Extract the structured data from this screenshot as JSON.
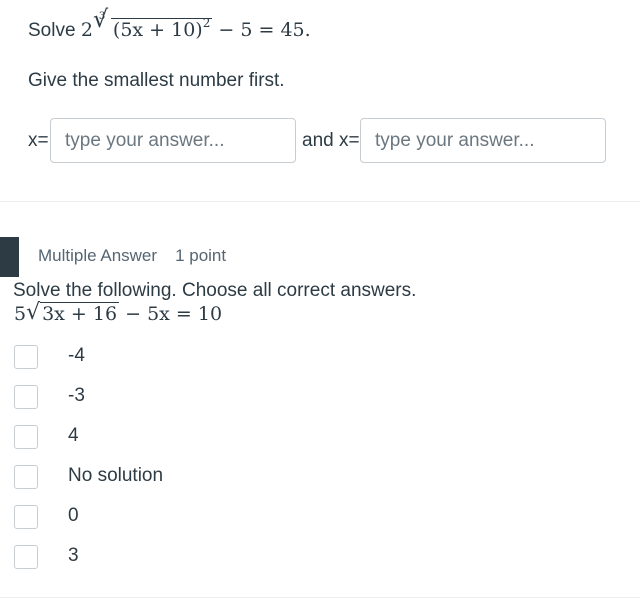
{
  "question1": {
    "prompt_word": "Solve",
    "equation": {
      "coefficient": "2",
      "root_index": "3",
      "radicand": "(5x + 10)",
      "exponent": "2",
      "rest": "− 5 = 45."
    },
    "instruction": "Give the smallest number first.",
    "answer1_label": "x=",
    "answer1_placeholder": "type your answer...",
    "answer2_label": "and x=",
    "answer2_placeholder": "type your answer..."
  },
  "question2": {
    "type": "Multiple Answer",
    "points": "1 point",
    "prompt": "Solve the following. Choose all correct answers.",
    "equation": {
      "coefficient": "5",
      "radicand": "3x + 16",
      "rest": "− 5x = 10"
    },
    "options": [
      {
        "label": "-4"
      },
      {
        "label": "-3"
      },
      {
        "label": "4"
      },
      {
        "label": "No solution"
      },
      {
        "label": "0"
      },
      {
        "label": "3"
      }
    ]
  }
}
